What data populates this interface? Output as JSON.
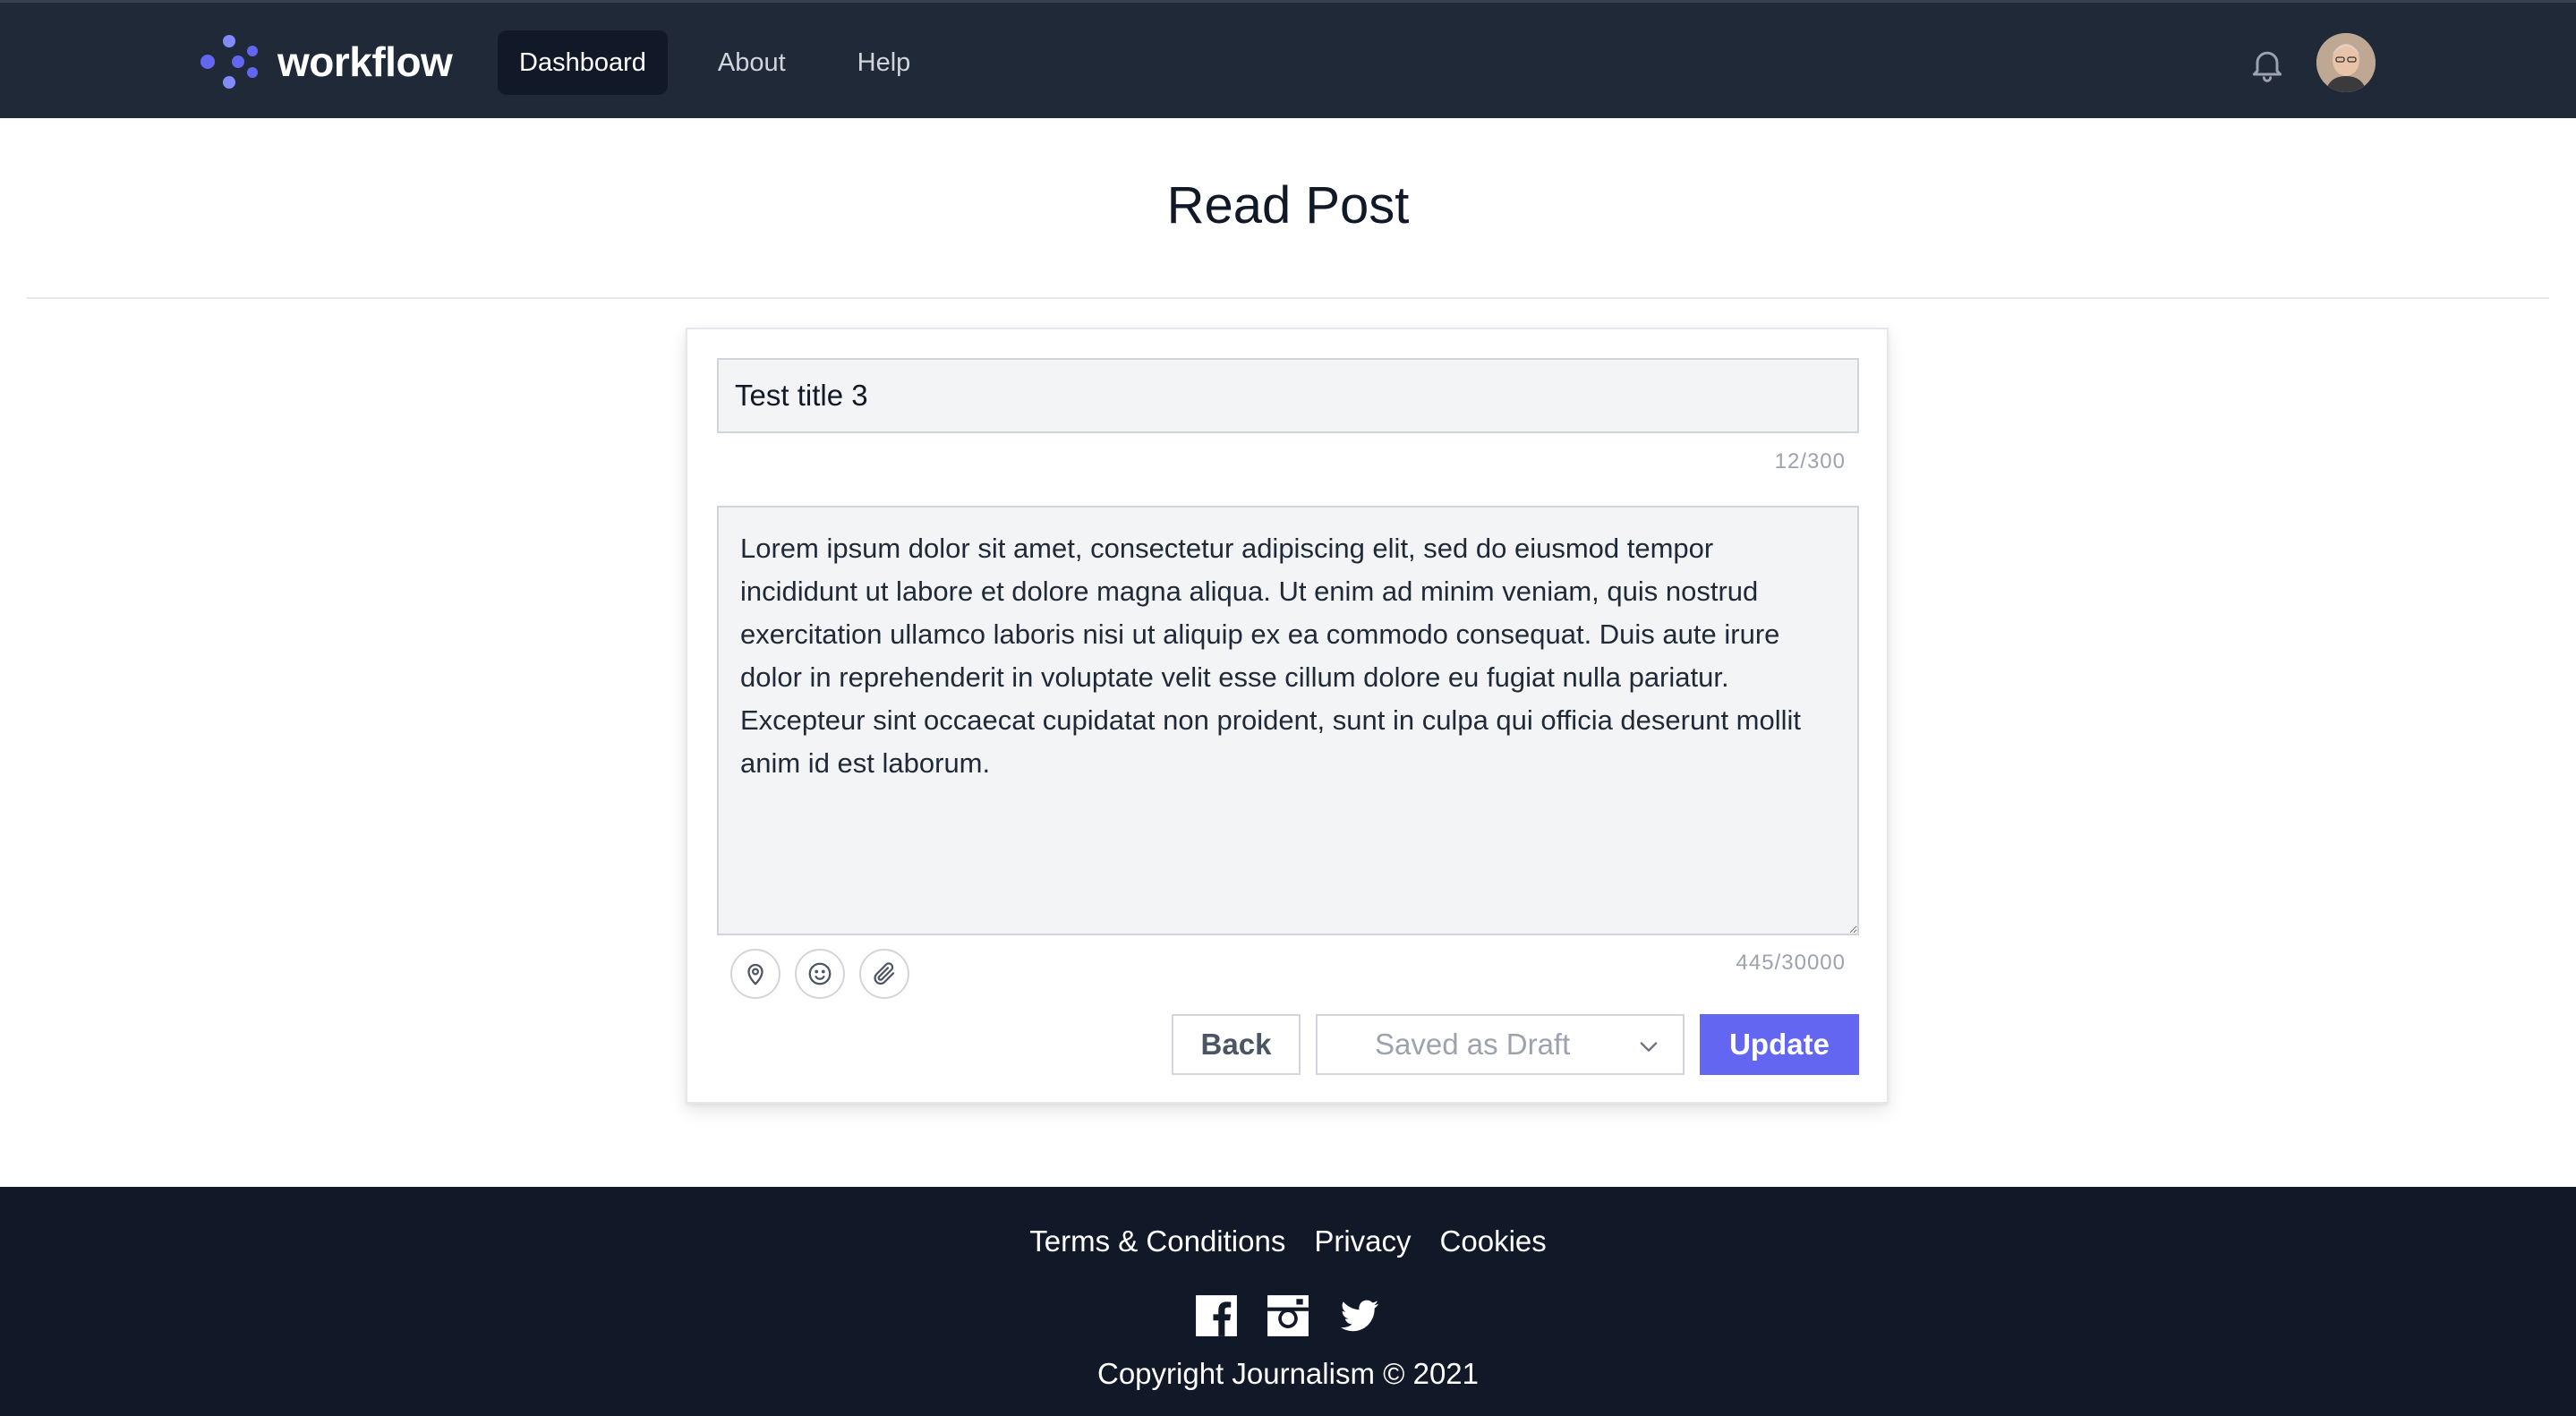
{
  "header": {
    "brand": "workflow",
    "nav": [
      {
        "label": "Dashboard",
        "active": true
      },
      {
        "label": "About",
        "active": false
      },
      {
        "label": "Help",
        "active": false
      }
    ],
    "notifications_icon": "bell-icon",
    "avatar_icon": "user-avatar"
  },
  "page": {
    "title": "Read Post"
  },
  "form": {
    "title_value": "Test title 3",
    "title_counter": "12/300",
    "body_value": "Lorem ipsum dolor sit amet, consectetur adipiscing elit, sed do eiusmod tempor incididunt ut labore et dolore magna aliqua. Ut enim ad minim veniam, quis nostrud exercitation ullamco laboris nisi ut aliquip ex ea commodo consequat. Duis aute irure dolor in reprehenderit in voluptate velit esse cillum dolore eu fugiat nulla pariatur. Excepteur sint occaecat cupidatat non proident, sunt in culpa qui officia deserunt mollit anim id est laborum.",
    "body_counter": "445/30000",
    "tools": [
      "location-icon",
      "emoji-icon",
      "paperclip-icon"
    ],
    "back_label": "Back",
    "status_value": "Saved as Draft",
    "update_label": "Update"
  },
  "footer": {
    "links": [
      "Terms & Conditions",
      "Privacy",
      "Cookies"
    ],
    "socials": [
      "facebook-icon",
      "instagram-icon",
      "twitter-icon"
    ],
    "copyright": "Copyright Journalism © 2021"
  },
  "colors": {
    "header_bg": "#1f2937",
    "footer_bg": "#111827",
    "accent": "#6366f1",
    "input_bg": "#f3f4f6"
  }
}
